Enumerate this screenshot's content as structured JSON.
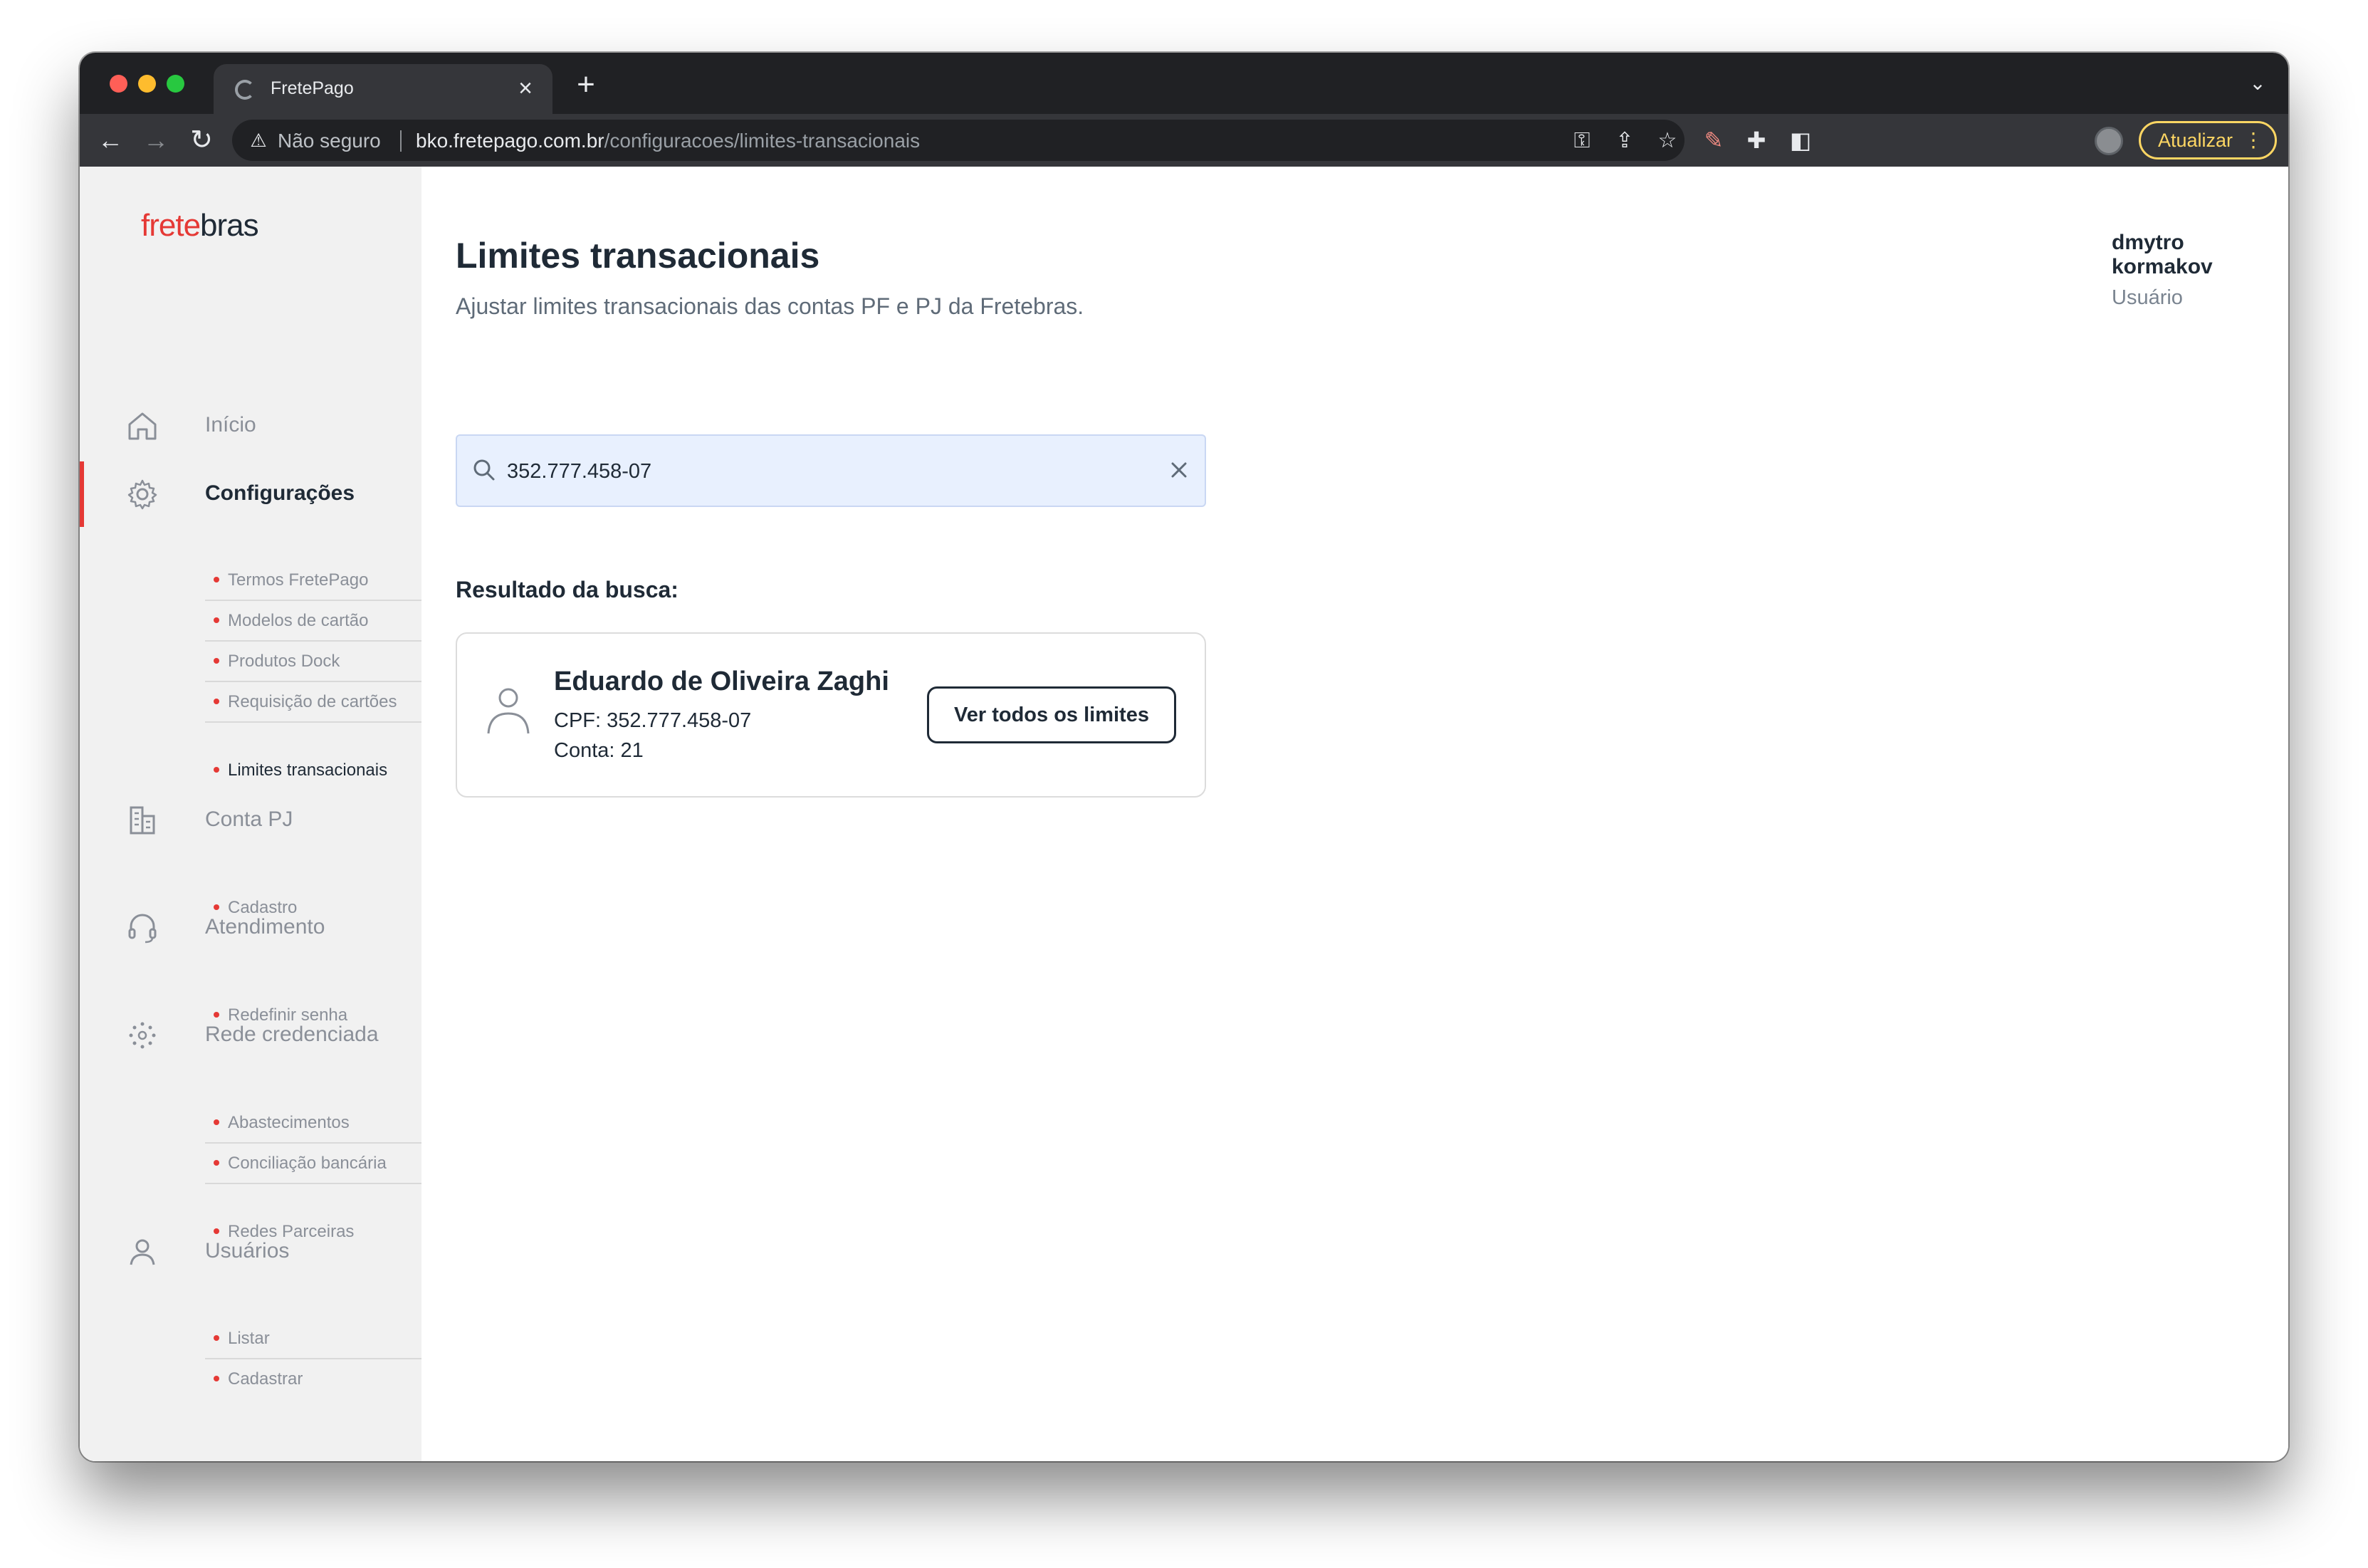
{
  "browser": {
    "tab_title": "FretePago",
    "security_label": "Não seguro",
    "url_host": "bko.fretepago.com.br",
    "url_path": "/configuracoes/limites-transacionais",
    "update_label": "Atualizar"
  },
  "logo": {
    "part1": "frete",
    "part2": "bras"
  },
  "sidebar": {
    "nav": [
      {
        "label": "Início",
        "icon": "home-icon"
      },
      {
        "label": "Configurações",
        "icon": "gear-icon"
      },
      {
        "label": "Conta PJ",
        "icon": "building-icon"
      },
      {
        "label": "Atendimento",
        "icon": "headset-icon"
      },
      {
        "label": "Rede credenciada",
        "icon": "network-icon"
      },
      {
        "label": "Usuários",
        "icon": "user-icon"
      }
    ],
    "config_items": [
      "Termos FretePago",
      "Modelos de cartão",
      "Produtos Dock",
      "Requisição de cartões",
      "Limites transacionais"
    ],
    "conta_pj_items": [
      "Cadastro"
    ],
    "atendimento_items": [
      "Redefinir senha"
    ],
    "rede_items": [
      "Abastecimentos",
      "Conciliação bancária",
      "Redes Parceiras"
    ],
    "usuarios_items": [
      "Listar",
      "Cadastrar"
    ]
  },
  "header": {
    "title": "Limites transacionais",
    "subtitle": "Ajustar limites transacionais das contas PF e PJ da Fretebras.",
    "user_name": "dmytro kormakov",
    "user_role": "Usuário"
  },
  "search": {
    "value": "352.777.458-07"
  },
  "results": {
    "heading": "Resultado da busca:",
    "name": "Eduardo de Oliveira Zaghi",
    "cpf": "CPF: 352.777.458-07",
    "conta": "Conta: 21",
    "button_label": "Ver todos os limites"
  },
  "colors": {
    "brand": "#e53935",
    "text": "#1f2a36",
    "search_bg": "#e8f0fe"
  }
}
